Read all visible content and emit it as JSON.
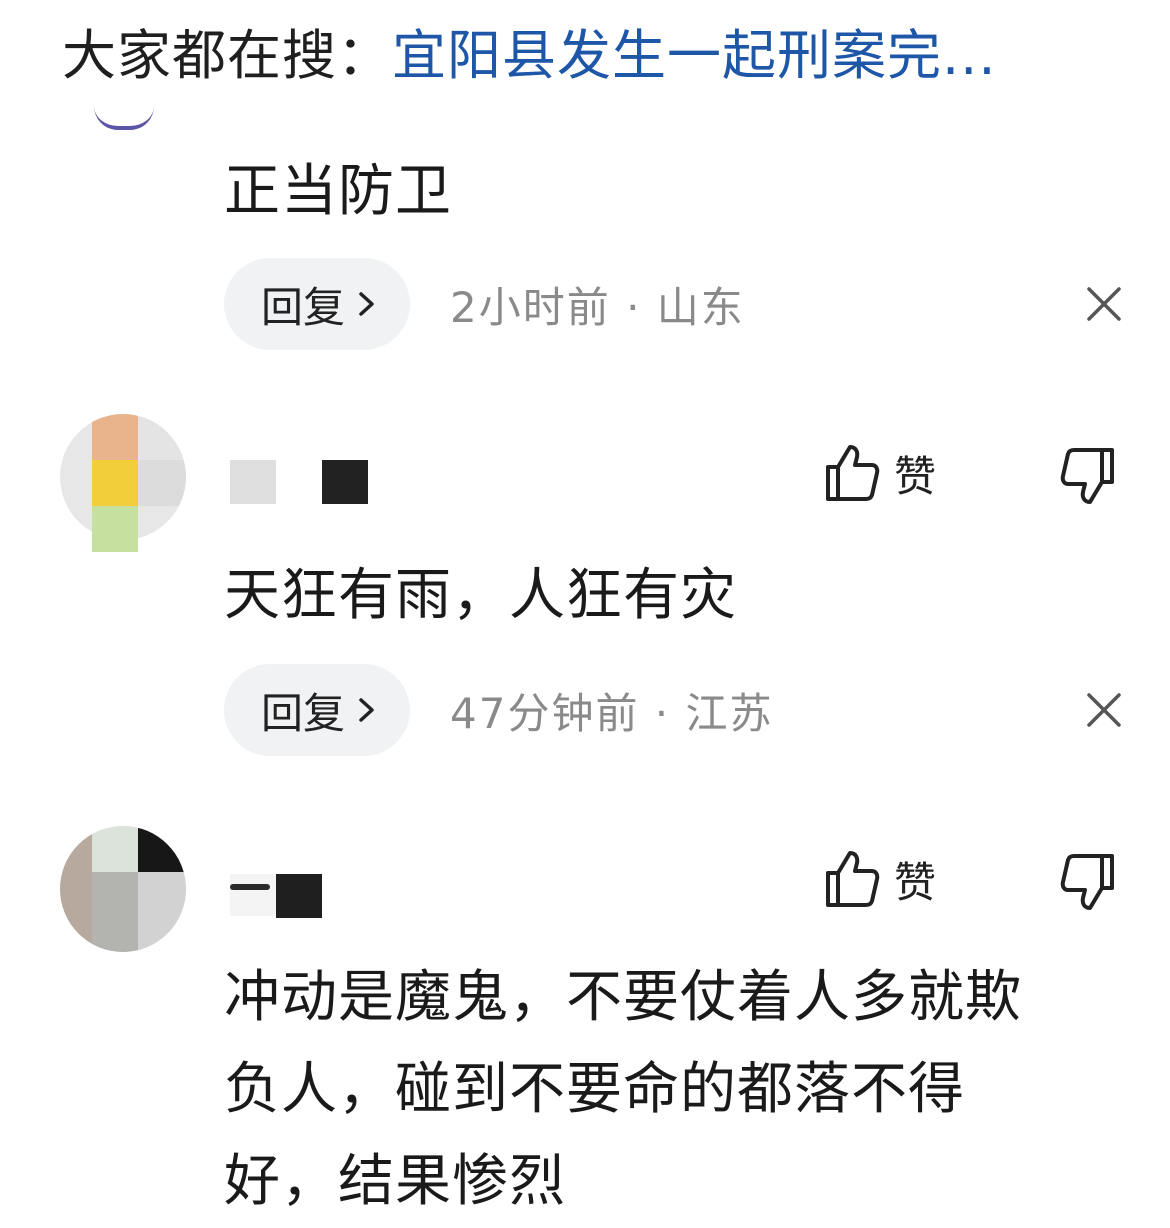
{
  "hot_search": {
    "label": "大家都在搜：",
    "link": "宜阳县发生一起刑案完..."
  },
  "comments": [
    {
      "text": "正当防卫",
      "reply_label": "回复",
      "meta": "2小时前 · 山东"
    },
    {
      "text": "天狂有雨，人狂有灾",
      "like_label": "赞",
      "reply_label": "回复",
      "meta": "47分钟前 · 江苏"
    },
    {
      "text_lines": [
        "冲动是魔鬼，不要仗着人多就欺",
        "负人，碰到不要命的都落不得",
        "好，结果惨烈"
      ],
      "like_label": "赞"
    }
  ]
}
